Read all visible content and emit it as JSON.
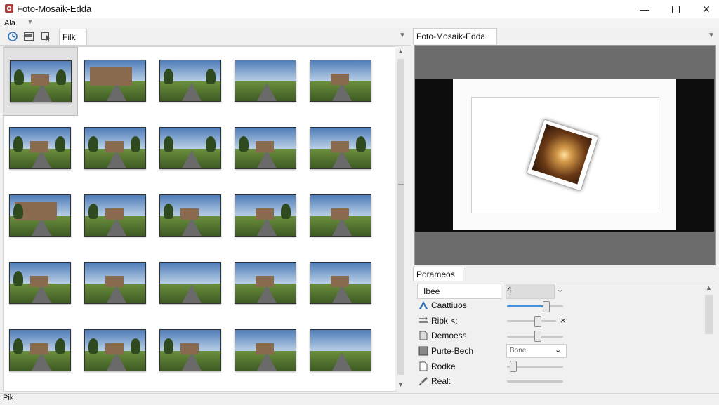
{
  "window": {
    "title": "Foto-Mosaik-Edda"
  },
  "menu": {
    "items": [
      {
        "label": "Ala"
      }
    ]
  },
  "left_toolbar": {
    "filter_tab": "Filk"
  },
  "preview": {
    "tab_label": "Foto-Mosaik-Edda"
  },
  "parameters": {
    "tab_label": "Porameos",
    "style_label": "Ibee",
    "style_value": "4",
    "rows": [
      {
        "label": "Caattiuos",
        "icon": "triangle-icon",
        "slider": 0.75
      },
      {
        "label": "Ribk <:",
        "icon": "adjust-icon",
        "slider": 0.55
      },
      {
        "label": "Demoess",
        "icon": "document-icon",
        "slider": 0.5
      },
      {
        "label": "Purte-Bech",
        "icon": "blend-icon",
        "select": "Bone"
      },
      {
        "label": "Rodke",
        "icon": "page-icon",
        "slider": 0.1
      },
      {
        "label": "Real:",
        "icon": "brush-icon"
      }
    ],
    "close_glyph": "×"
  },
  "statusbar": {
    "text": "Pik"
  },
  "colors": {
    "accent": "#4a90d9",
    "title_icon": "#b03a3a"
  }
}
